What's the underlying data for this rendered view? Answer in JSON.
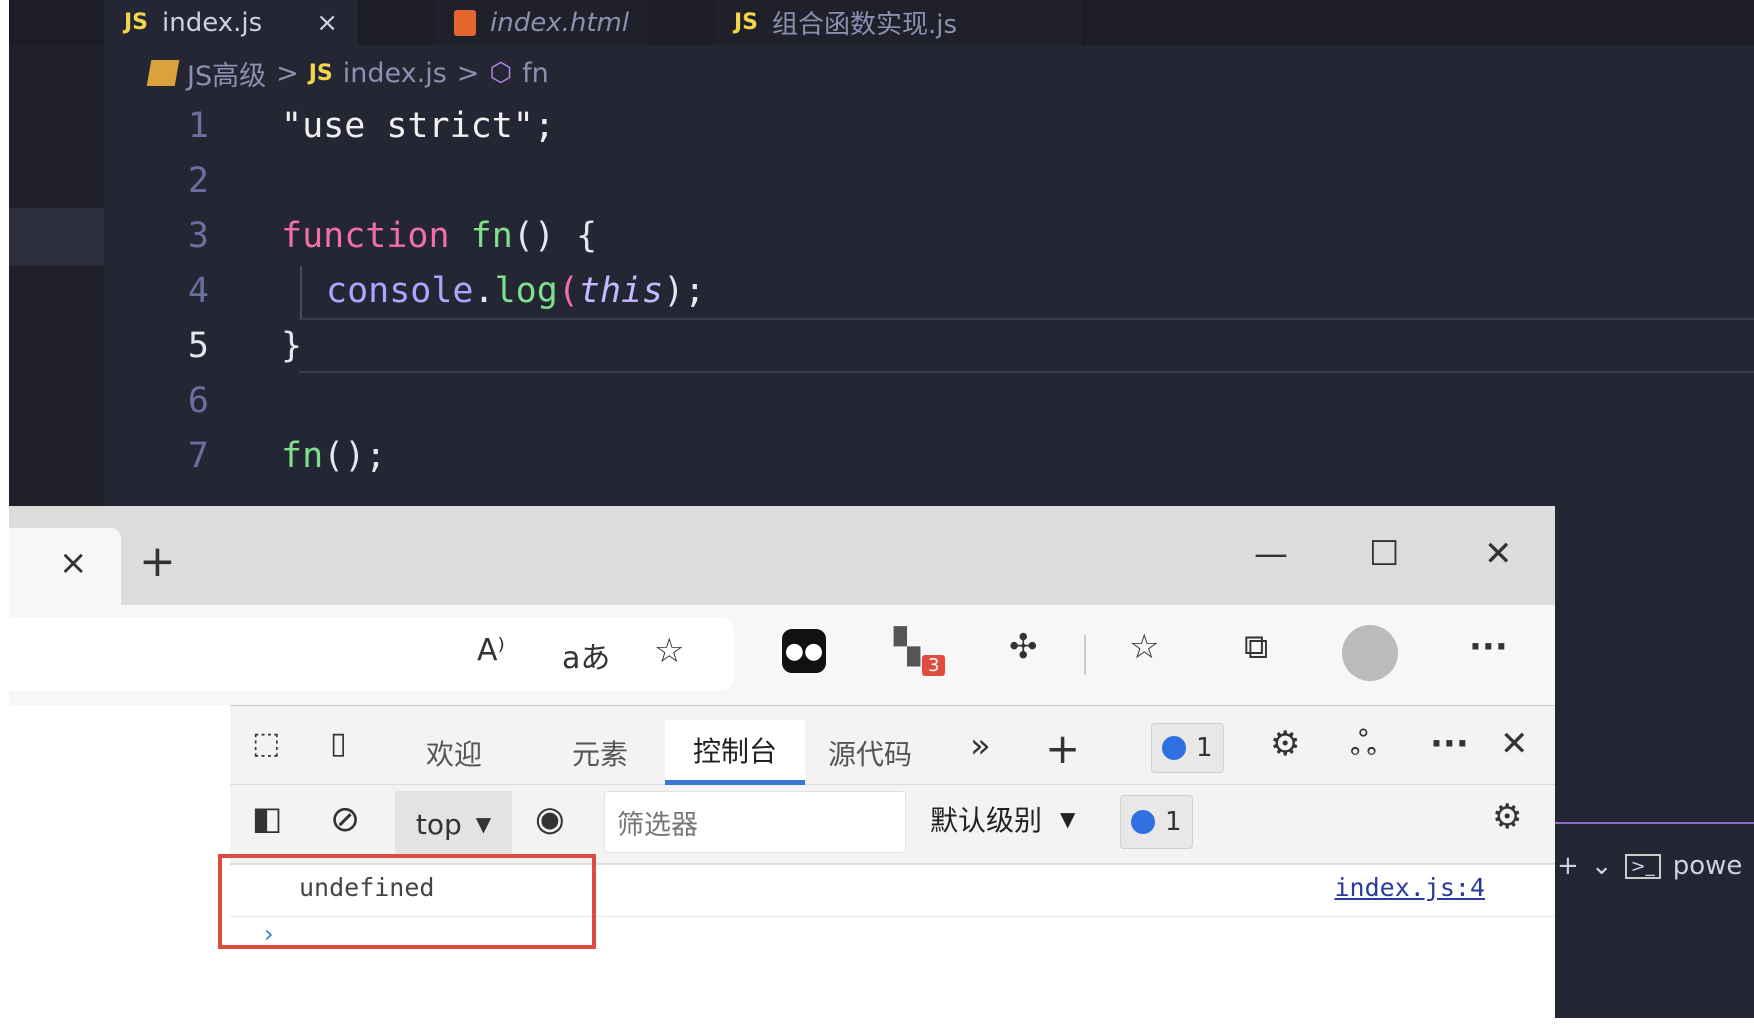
{
  "editor": {
    "tabs": [
      {
        "label": "index.js",
        "icon": "js",
        "close": "×"
      },
      {
        "label": "index.html",
        "icon": "html"
      },
      {
        "label": "组合函数实现.js",
        "icon": "js"
      }
    ],
    "js_badge": "JS",
    "breadcrumb": {
      "folder": "JS高级",
      "file": "index.js",
      "symbol": "fn",
      "sep": ">"
    },
    "lines": [
      {
        "n": "1",
        "code": "\"use strict\";"
      },
      {
        "n": "2",
        "code": ""
      },
      {
        "n": "3",
        "code": "function fn() {"
      },
      {
        "n": "4",
        "code": "console.log(this);"
      },
      {
        "n": "5",
        "code": "}"
      },
      {
        "n": "6",
        "code": ""
      },
      {
        "n": "7",
        "code": "fn();"
      }
    ],
    "tokens": {
      "kw_function": "function",
      "fn_name": "fn",
      "parens_brace": "() {",
      "console": "console",
      "dot": ".",
      "log": "log",
      "open": "(",
      "this": "this",
      "close": ");",
      "use_strict": "\"use strict\";",
      "brace": "}",
      "call": "fn",
      "call_rest": "();"
    }
  },
  "terminal": {
    "plus": "+",
    "chev": "⌄",
    "label": "powe"
  },
  "browser": {
    "tab_close": "×",
    "new_tab": "+",
    "window": {
      "minimize": "—",
      "maximize": "☐",
      "close": "✕"
    },
    "extension_badge": "3",
    "more": "···"
  },
  "devtools": {
    "tabs": [
      "欢迎",
      "元素",
      "控制台",
      "源代码"
    ],
    "active_tab": "控制台",
    "more_tabs": "»",
    "add": "+",
    "issues_count": "1",
    "context": "top",
    "filter_placeholder": "筛选器",
    "level": "默认级别",
    "msg_count": "1",
    "console": {
      "message": "undefined",
      "source": "index.js:4",
      "prompt": "›"
    },
    "more": "···",
    "close": "✕"
  },
  "colors": {
    "highlight": "#e04a3f",
    "accent": "#3a78d6"
  }
}
